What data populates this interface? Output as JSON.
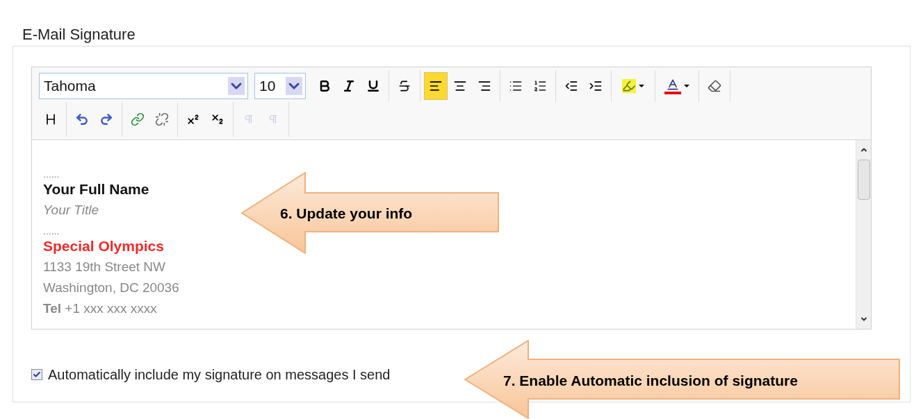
{
  "section": {
    "title": "E-Mail Signature"
  },
  "toolbar": {
    "font": "Tahoma",
    "size": "10",
    "align_buttons": [
      {
        "selected": true
      },
      {
        "selected": false
      },
      {
        "selected": false
      }
    ],
    "direction_buttons": [
      {
        "disabled": true
      },
      {
        "disabled": true
      }
    ]
  },
  "signature": [
    {
      "kind": "dots",
      "text": "......"
    },
    {
      "kind": "name",
      "text": "Your Full Name"
    },
    {
      "kind": "title",
      "text": "Your Title"
    },
    {
      "kind": "dots",
      "text": "......"
    },
    {
      "kind": "org",
      "text": "Special Olympics"
    },
    {
      "kind": "address",
      "text": "1133 19th Street NW"
    },
    {
      "kind": "address",
      "text": "Washington, DC 20036"
    },
    {
      "kind": "address",
      "text": "**Tel** +1 xxx xxx xxxx"
    }
  ],
  "auto_include": {
    "label": "Automatically include my signature on messages I send",
    "checked": true
  },
  "callouts": [
    {
      "text": "6. Update your info"
    },
    {
      "text": "7. Enable Automatic inclusion of signature"
    }
  ]
}
